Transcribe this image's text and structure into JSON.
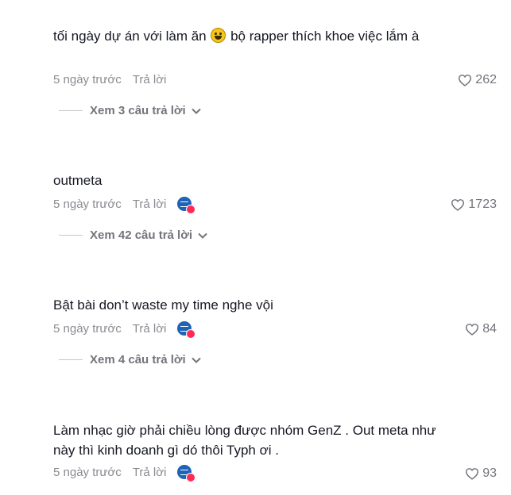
{
  "comments": [
    {
      "text_before_emoji": "tối ngày dự án với làm ăn ",
      "emoji": "grinning-face-emoji",
      "text_after_emoji": " bộ rapper thích khoe việc lắm à",
      "time": "5 ngày trước",
      "reply_label": "Trả lời",
      "likes": "262",
      "view_replies": "Xem 3 câu trả lời"
    },
    {
      "text": "outmeta",
      "time": "5 ngày trước",
      "reply_label": "Trả lời",
      "creator_badge": "creator-liked-avatar",
      "likes": "1723",
      "view_replies": "Xem 42 câu trả lời"
    },
    {
      "text": "Bật bài don’t waste my time nghe vội",
      "time": "5 ngày trước",
      "reply_label": "Trả lời",
      "creator_badge": "creator-liked-avatar",
      "likes": "84",
      "view_replies": "Xem 4 câu trả lời"
    },
    {
      "text": "Làm nhạc giờ phải chiều lòng được nhóm GenZ . Out meta như này thì kinh doanh gì dó thôi Typh ơi .",
      "time": "5 ngày trước",
      "reply_label": "Trả lời",
      "creator_badge": "creator-liked-avatar",
      "likes": "93"
    }
  ],
  "colors": {
    "text": "#161823",
    "secondary": "#8a8b91",
    "badge_blue": "#1e63b8",
    "badge_heart": "#fe2c55"
  }
}
